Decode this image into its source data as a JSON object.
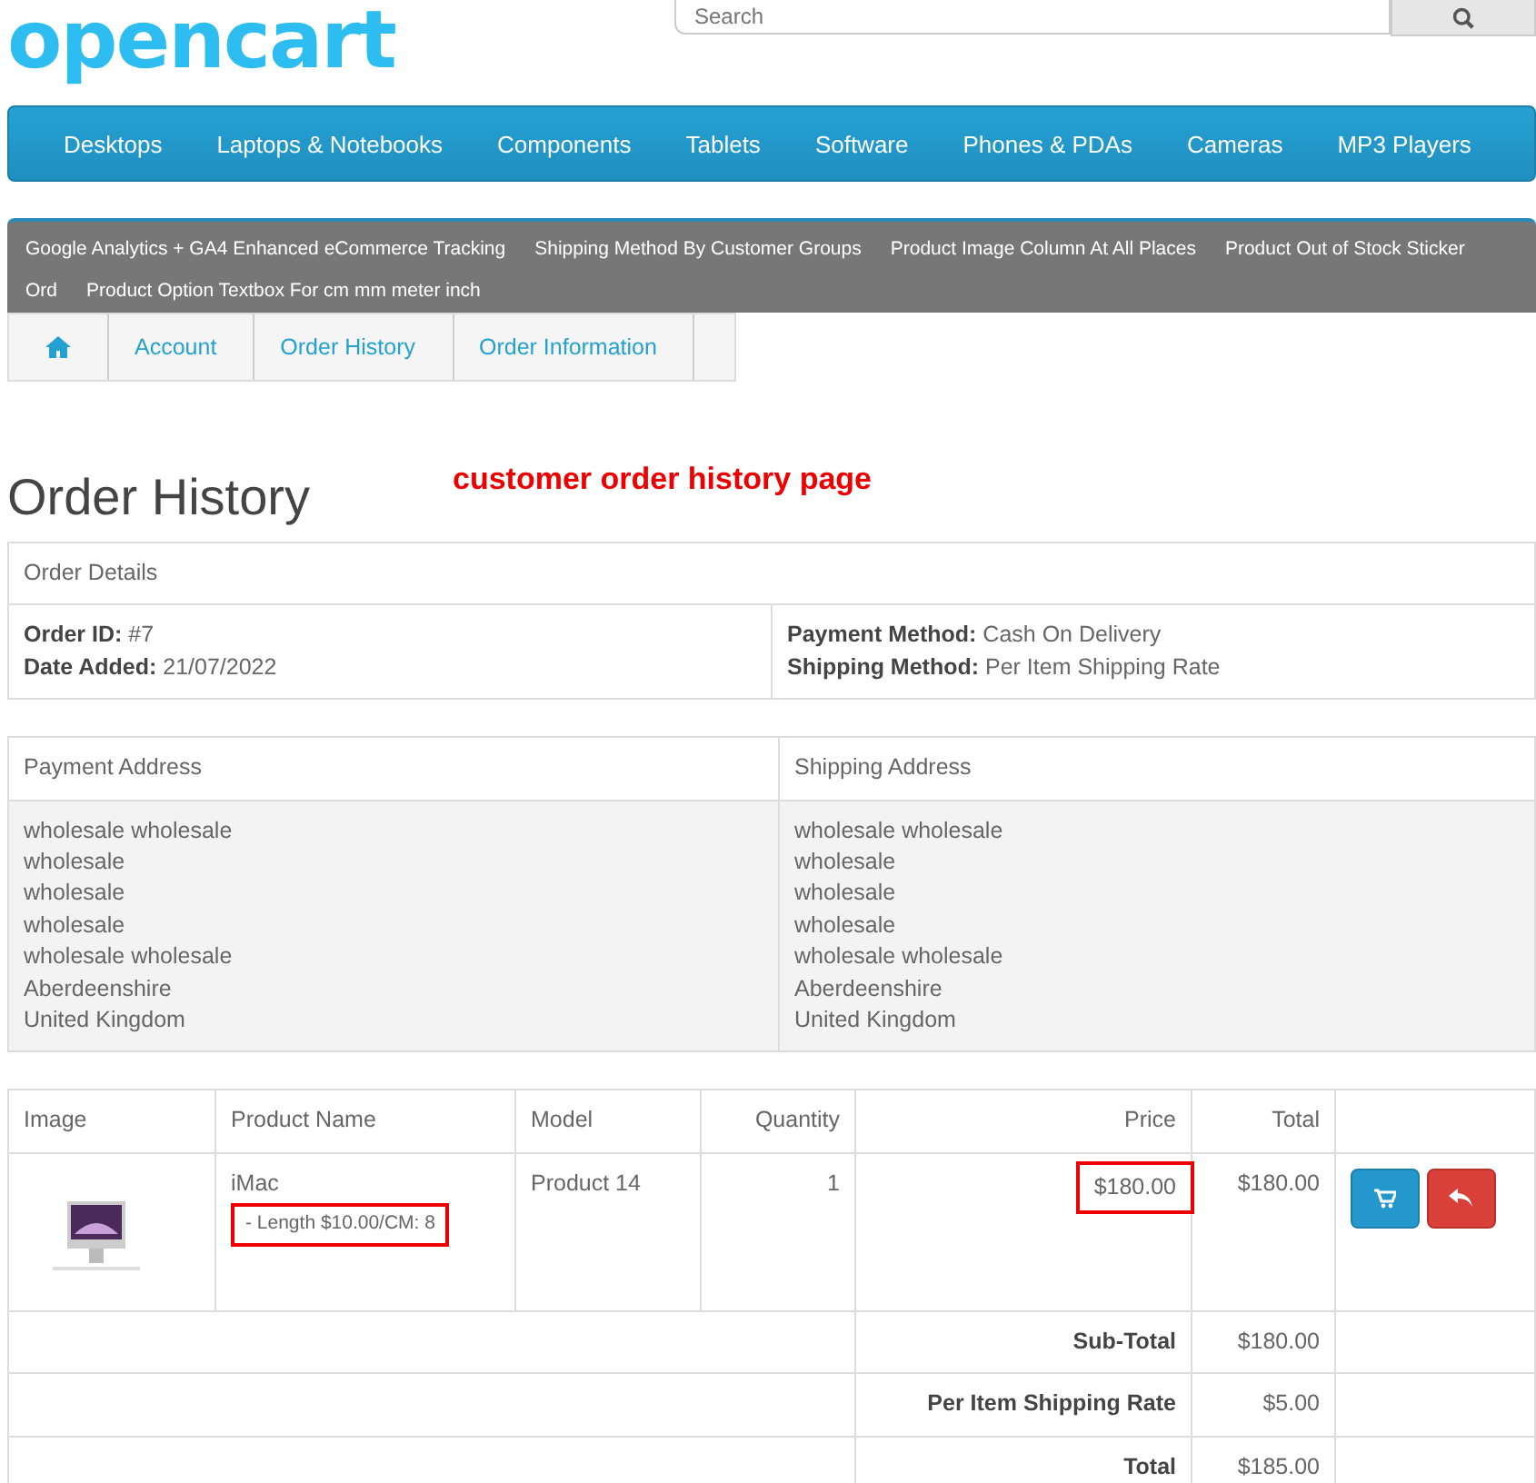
{
  "logo": {
    "text": "opencart"
  },
  "search": {
    "placeholder": "Search"
  },
  "menu": [
    "Desktops",
    "Laptops & Notebooks",
    "Components",
    "Tablets",
    "Software",
    "Phones & PDAs",
    "Cameras",
    "MP3 Players"
  ],
  "modules": [
    "Google Analytics + GA4 Enhanced eCommerce Tracking",
    "Shipping Method By Customer Groups",
    "Product Image Column At All Places",
    "Product Out of Stock Sticker",
    "Ord",
    "Product Option Textbox For cm mm meter inch"
  ],
  "breadcrumb": [
    "Account",
    "Order History",
    "Order Information"
  ],
  "page_title": "Order History",
  "annotation": "customer order history page",
  "order_details": {
    "heading": "Order Details",
    "left": [
      {
        "label": "Order ID:",
        "value": "#7"
      },
      {
        "label": "Date Added:",
        "value": "21/07/2022"
      }
    ],
    "right": [
      {
        "label": "Payment Method:",
        "value": "Cash On Delivery"
      },
      {
        "label": "Shipping Method:",
        "value": "Per Item Shipping Rate"
      }
    ]
  },
  "addresses": {
    "columns": [
      "Payment Address",
      "Shipping Address"
    ],
    "payment": [
      "wholesale wholesale",
      "wholesale",
      "wholesale",
      "wholesale",
      "wholesale wholesale",
      "Aberdeenshire",
      "United Kingdom"
    ],
    "shipping": [
      "wholesale wholesale",
      "wholesale",
      "wholesale",
      "wholesale",
      "wholesale wholesale",
      "Aberdeenshire",
      "United Kingdom"
    ]
  },
  "products": {
    "columns": [
      "Image",
      "Product Name",
      "Model",
      "Quantity",
      "Price",
      "Total"
    ],
    "rows": [
      {
        "name": "iMac",
        "option": "- Length $10.00/CM: 8",
        "option_highlighted": true,
        "model": "Product 14",
        "quantity": "1",
        "price": "$180.00",
        "price_highlighted": true,
        "total": "$180.00"
      }
    ],
    "totals": [
      {
        "label": "Sub-Total",
        "value": "$180.00"
      },
      {
        "label": "Per Item Shipping Rate",
        "value": "$5.00"
      },
      {
        "label": "Total",
        "value": "$185.00"
      }
    ]
  }
}
